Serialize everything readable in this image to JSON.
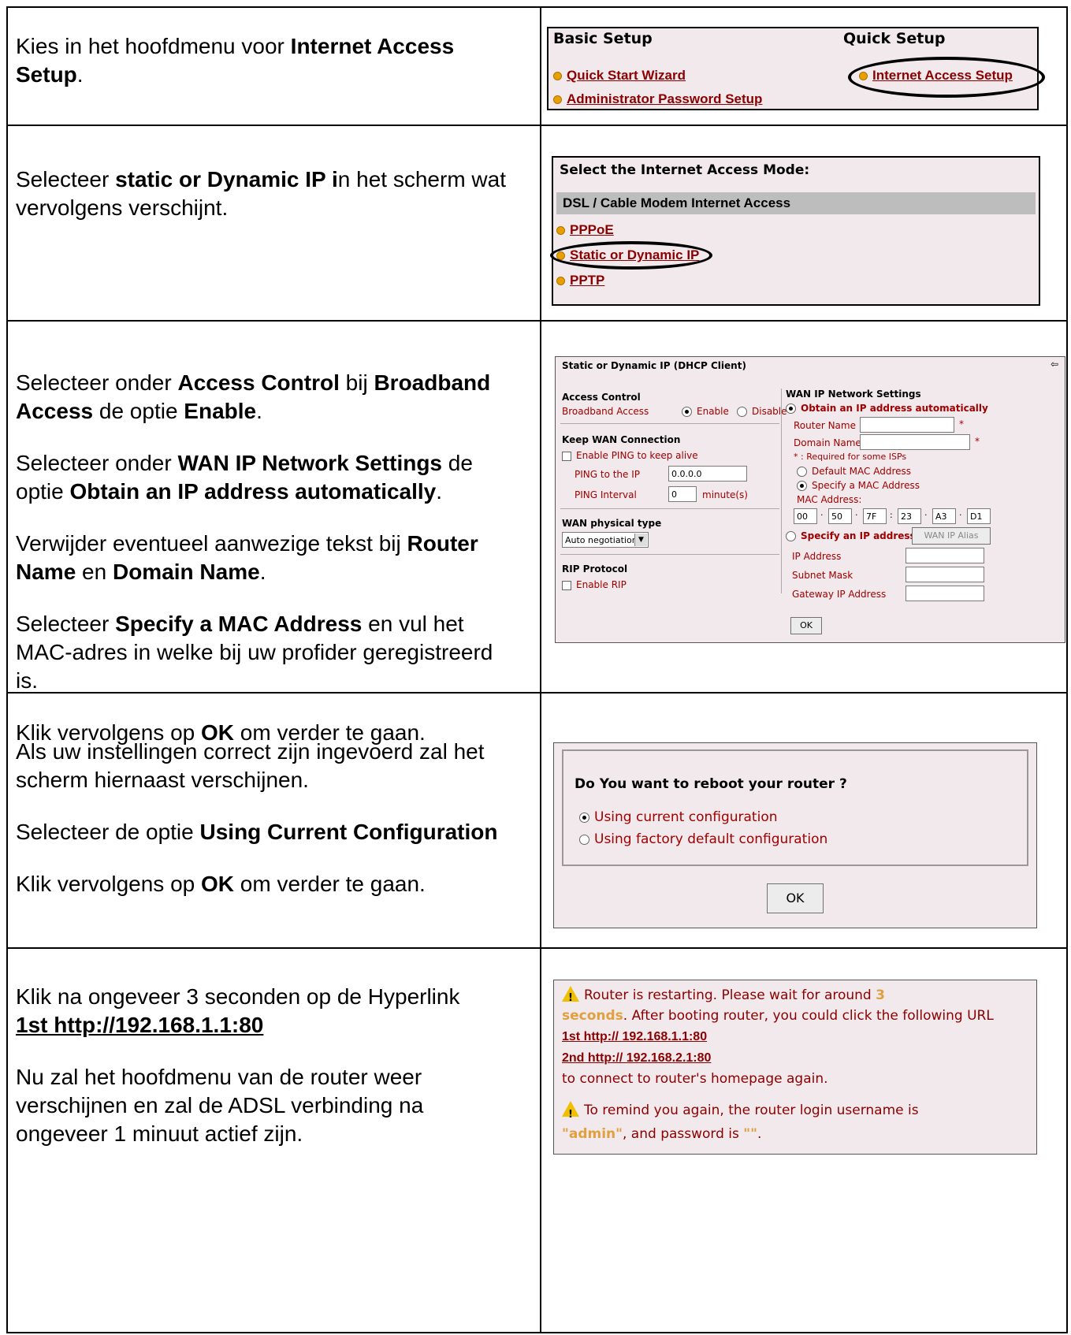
{
  "rows": [
    {
      "instructions": [
        "Kies in het hoofdmenu voor ",
        "Internet Access Setup",
        "."
      ],
      "panel": {
        "basic_setup": "Basic Setup",
        "quick_setup": "Quick Setup",
        "links": [
          "Quick Start Wizard",
          "Administrator Password Setup",
          "Internet Access Setup"
        ]
      }
    },
    {
      "instructions": [
        "Selecteer ",
        "static or Dynamic IP i",
        "n het scherm wat vervolgens verschijnt."
      ],
      "panel": {
        "title": "Select the Internet Access Mode:",
        "section": "DSL / Cable Modem Internet Access",
        "links": [
          "PPPoE",
          "Static or Dynamic IP",
          "PPTP"
        ]
      }
    },
    {
      "p1": [
        "Selecteer onder ",
        "Access Control",
        " bij ",
        "Broadband Access",
        " de optie ",
        "Enable",
        "."
      ],
      "p2": [
        "Selecteer onder ",
        "WAN IP Network Settings",
        " de optie ",
        "Obtain an IP address automatically",
        "."
      ],
      "p3": [
        "Verwijder eventueel aanwezige tekst bij ",
        "Router Name",
        " en ",
        "Domain Name",
        "."
      ],
      "p4": [
        "Selecteer ",
        "Specify a MAC Address",
        " en vul het MAC-adres in welke bij uw profider geregistreerd is."
      ],
      "p5": [
        "Klik vervolgens op ",
        "OK",
        " om verder te gaan."
      ],
      "panel": {
        "title": "Static or Dynamic IP (DHCP Client)",
        "access_control": "Access Control",
        "broadband_access": "Broadband Access",
        "enable": "Enable",
        "disable": "Disable",
        "keep_wan": "Keep WAN Connection",
        "enable_ping": "Enable PING to keep alive",
        "ping_ip_label": "PING to the IP",
        "ping_ip_value": "0.0.0.0",
        "ping_interval_label": "PING Interval",
        "ping_interval_value": "0",
        "minutes": "minute(s)",
        "wan_physical": "WAN physical type",
        "wan_physical_value": "Auto negotiation",
        "rip": "RIP Protocol",
        "enable_rip": "Enable RIP",
        "wan_ip": "WAN IP Network Settings",
        "obtain_auto": "Obtain an IP address automatically",
        "router_name": "Router Name",
        "domain_name": "Domain Name",
        "star": "*",
        "required_note": "* : Required for some ISPs",
        "default_mac": "Default MAC Address",
        "specify_mac": "Specify a MAC Address",
        "mac_label": "MAC Address:",
        "mac": [
          "00",
          "50",
          "7F",
          "23",
          "A3",
          "D1"
        ],
        "specify_ip": "Specify an IP address",
        "wan_alias": "WAN IP Alias",
        "ip_address": "IP Address",
        "subnet_mask": "Subnet Mask",
        "gateway": "Gateway IP Address",
        "ok": "OK"
      }
    },
    {
      "p1": "Als uw instellingen correct zijn ingevoerd zal het scherm hiernaast verschijnen.",
      "p2": [
        "Selecteer de optie ",
        "Using Current Configuration"
      ],
      "p3": [
        "Klik vervolgens op ",
        "OK",
        " om verder te gaan."
      ],
      "panel": {
        "question": "Do You want to reboot your router ?",
        "opt1": "Using current configuration",
        "opt2": "Using factory default configuration",
        "ok": "OK"
      }
    },
    {
      "p1": [
        "Klik na ongeveer 3 seconden op de Hyperlink ",
        "1st http://192.168.1.1:80"
      ],
      "p2": "Nu zal het hoofdmenu van de router weer verschijnen en zal de ADSL verbinding na ongeveer 1 minuut actief zijn.",
      "panel": {
        "msg_a": "Router is restarting. Please wait for around ",
        "msg_num": "3",
        "msg_sec": "seconds",
        "msg_b": ". After booting router, you could click the following URL",
        "link1": "1st http:// 192.168.1.1:80",
        "link2": "2nd http:// 192.168.2.1:80",
        "msg_c": "to connect to router's homepage again.",
        "remind_a": "To remind you again, the router login username is",
        "username": "\"admin\"",
        "remind_b": ", and password is ",
        "password": "\"\"",
        "remind_c": "."
      }
    }
  ]
}
